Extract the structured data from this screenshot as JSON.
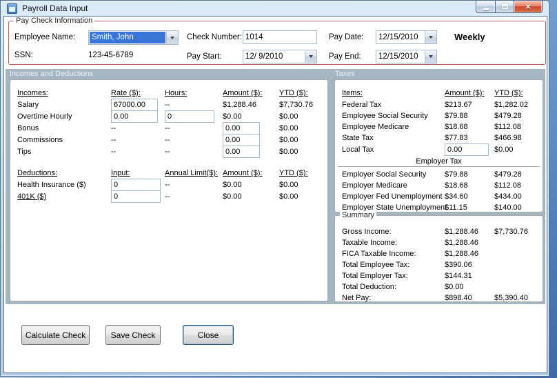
{
  "window": {
    "title": "Payroll Data Input",
    "close_glyph": "×"
  },
  "paycheck": {
    "group_label": "Pay Check Information",
    "employee_name": {
      "label": "Employee Name:",
      "value": "Smith, John"
    },
    "ssn": {
      "label": "SSN:",
      "value": "123-45-6789"
    },
    "check_number": {
      "label": "Check Number:",
      "value": "1014"
    },
    "pay_start": {
      "label": "Pay Start:",
      "value": "12/ 9/2010"
    },
    "pay_date": {
      "label": "Pay Date:",
      "value": "12/15/2010"
    },
    "pay_end": {
      "label": "Pay End:",
      "value": "12/15/2010"
    },
    "frequency": "Weekly"
  },
  "sections": {
    "incomes_deductions_label": "Incomes and Deductions",
    "taxes_label": "Taxes"
  },
  "incomes": {
    "headers": {
      "name": "Incomes:",
      "rate": "Rate ($):",
      "hours": "Hours:",
      "amount": "Amount ($):",
      "ytd": "YTD ($):"
    },
    "rows": [
      {
        "label": "Salary",
        "rate": "67000.00",
        "hours": "--",
        "amount": "$1,288.46",
        "ytd": "$7,730.76"
      },
      {
        "label": "Overtime Hourly",
        "rate": "0.00",
        "hours": "0",
        "amount": "$0.00",
        "ytd": "$0.00"
      },
      {
        "label": "Bonus",
        "rate": "--",
        "hours": "--",
        "amount": "0.00",
        "ytd": "$0.00"
      },
      {
        "label": "Commissions",
        "rate": "--",
        "hours": "--",
        "amount": "0.00",
        "ytd": "$0.00"
      },
      {
        "label": "Tips",
        "rate": "--",
        "hours": "--",
        "amount": "0.00",
        "ytd": "$0.00"
      }
    ]
  },
  "deductions": {
    "headers": {
      "name": "Deductions:",
      "input": "Input:",
      "limit": "Annual Limit($):",
      "amount": "Amount ($):",
      "ytd": "YTD ($):"
    },
    "rows": [
      {
        "label": "Health Insurance ($)",
        "input": "0",
        "limit": "--",
        "amount": "$0.00",
        "ytd": "$0.00"
      },
      {
        "label": "401K ($)",
        "input": "0",
        "limit": "--",
        "amount": "$0.00",
        "ytd": "$0.00"
      }
    ]
  },
  "taxes": {
    "headers": {
      "items": "Items:",
      "amount": "Amount ($):",
      "ytd": "YTD ($):"
    },
    "employee_rows": [
      {
        "label": "Federal Tax",
        "amount": "$213.67",
        "ytd": "$1,282.02"
      },
      {
        "label": "Employee Social Security",
        "amount": "$79.88",
        "ytd": "$479.28"
      },
      {
        "label": "Employee Medicare",
        "amount": "$18.68",
        "ytd": "$112.08"
      },
      {
        "label": "State Tax",
        "amount": "$77.83",
        "ytd": "$466.98"
      },
      {
        "label": "Local Tax",
        "amount": "0.00",
        "ytd": "$0.00"
      }
    ],
    "employer_header": "Employer Tax",
    "employer_rows": [
      {
        "label": "Employer Social Security",
        "amount": "$79.88",
        "ytd": "$479.28"
      },
      {
        "label": "Employer Medicare",
        "amount": "$18.68",
        "ytd": "$112.08"
      },
      {
        "label": "Employer Fed Unemployment",
        "amount": "$34.60",
        "ytd": "$434.00"
      },
      {
        "label": "Employer State Unemployment",
        "amount": "$11.15",
        "ytd": "$140.00"
      }
    ]
  },
  "summary": {
    "group_label": "Summary",
    "rows": [
      {
        "label": "Gross Income:",
        "amount": "$1,288.46",
        "ytd": "$7,730.76"
      },
      {
        "label": "Taxable Income:",
        "amount": "$1,288.46",
        "ytd": ""
      },
      {
        "label": "FICA Taxable Income:",
        "amount": "$1,288.46",
        "ytd": ""
      },
      {
        "label": "Total Employee Tax:",
        "amount": "$390.06",
        "ytd": ""
      },
      {
        "label": "Total Employer Tax:",
        "amount": "$144.31",
        "ytd": ""
      },
      {
        "label": "Total Deduction:",
        "amount": "$0.00",
        "ytd": ""
      },
      {
        "label": "Net Pay:",
        "amount": "$898.40",
        "ytd": "$5,390.40"
      }
    ]
  },
  "buttons": {
    "calculate": "Calculate Check",
    "save": "Save Check",
    "close": "Close"
  }
}
